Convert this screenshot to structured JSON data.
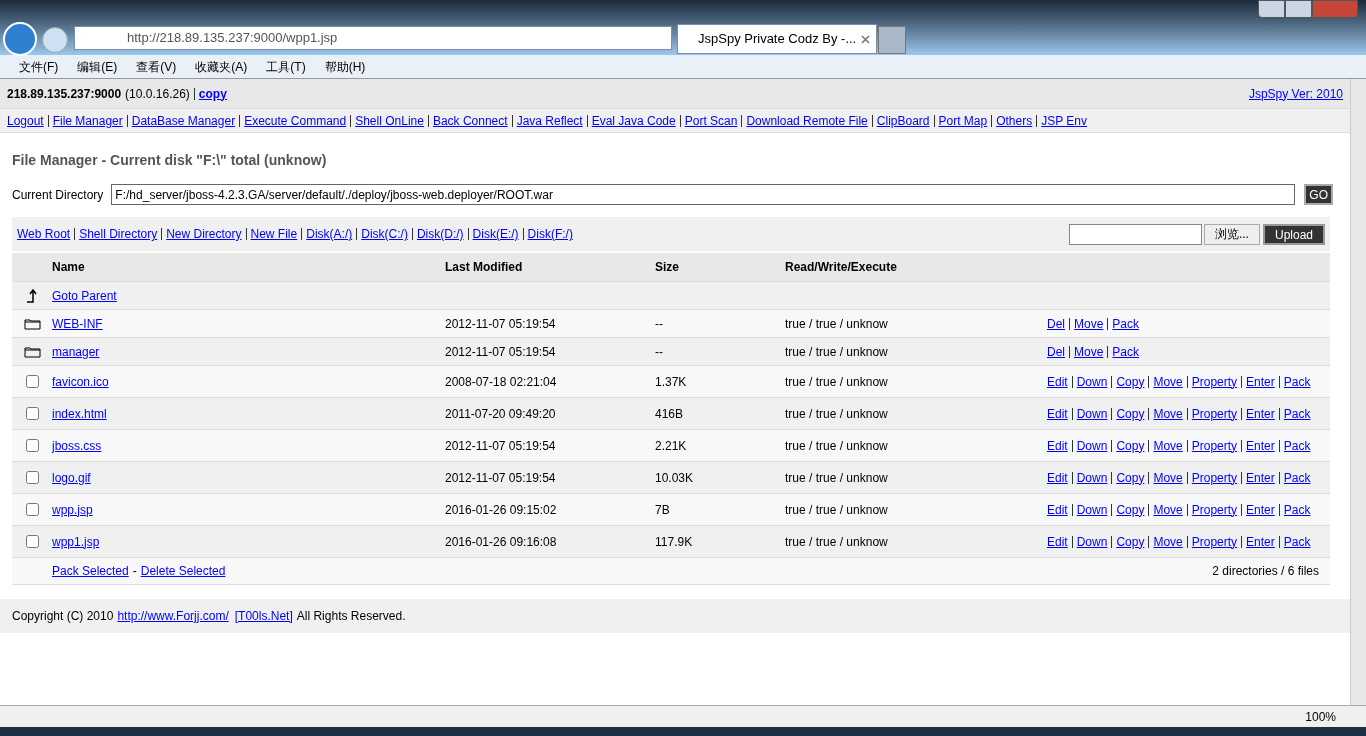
{
  "browser": {
    "address": "http://218.89.135.237:9000/wpp1.jsp",
    "tab_title": "JspSpy Private Codz By -...",
    "menu": [
      "文件(F)",
      "编辑(E)",
      "查看(V)",
      "收藏夹(A)",
      "工具(T)",
      "帮助(H)"
    ],
    "zoom": "100%"
  },
  "header": {
    "host": "218.89.135.237:9000",
    "ip": "(10.0.16.26)",
    "copy_link": "copy",
    "version_link": "JspSpy Ver: 2010"
  },
  "nav": [
    "Logout",
    "File Manager",
    "DataBase Manager",
    "Execute Command",
    "Shell OnLine",
    "Back Connect",
    "Java Reflect",
    "Eval Java Code",
    "Port Scan",
    "Download Remote File",
    "ClipBoard",
    "Port Map",
    "Others",
    "JSP Env"
  ],
  "title": "File Manager - Current disk \"F:\\\" total (unknow)",
  "directory": {
    "label": "Current Directory",
    "value": "F:/hd_server/jboss-4.2.3.GA/server/default/./deploy/jboss-web.deployer/ROOT.war",
    "go": "GO"
  },
  "shortcuts": [
    "Web Root",
    "Shell Directory",
    "New Directory",
    "New File",
    "Disk(A:/)",
    "Disk(C:/)",
    "Disk(D:/)",
    "Disk(E:/)",
    "Disk(F:/)"
  ],
  "upload": {
    "browse": "浏览...",
    "button": "Upload"
  },
  "table": {
    "columns": [
      "Name",
      "Last Modified",
      "Size",
      "Read/Write/Execute"
    ],
    "rows": [
      {
        "kind": "parent",
        "name": "Goto Parent"
      },
      {
        "kind": "dir",
        "name": "WEB-INF",
        "modified": "2012-11-07 05:19:54",
        "size": "--",
        "rwx": "true / true / unknow",
        "actions": [
          "Del",
          "Move",
          "Pack"
        ]
      },
      {
        "kind": "dir",
        "name": "manager",
        "modified": "2012-11-07 05:19:54",
        "size": "--",
        "rwx": "true / true / unknow",
        "actions": [
          "Del",
          "Move",
          "Pack"
        ]
      },
      {
        "kind": "file",
        "checked": false,
        "name": "favicon.ico",
        "modified": "2008-07-18 02:21:04",
        "size": "1.37K",
        "rwx": "true / true / unknow",
        "actions": [
          "Edit",
          "Down",
          "Copy",
          "Move",
          "Property",
          "Enter",
          "Pack"
        ]
      },
      {
        "kind": "file",
        "checked": false,
        "name": "index.html",
        "modified": "2011-07-20 09:49:20",
        "size": "416B",
        "rwx": "true / true / unknow",
        "actions": [
          "Edit",
          "Down",
          "Copy",
          "Move",
          "Property",
          "Enter",
          "Pack"
        ]
      },
      {
        "kind": "file",
        "checked": false,
        "name": "jboss.css",
        "modified": "2012-11-07 05:19:54",
        "size": "2.21K",
        "rwx": "true / true / unknow",
        "actions": [
          "Edit",
          "Down",
          "Copy",
          "Move",
          "Property",
          "Enter",
          "Pack"
        ]
      },
      {
        "kind": "file",
        "checked": false,
        "name": "logo.gif",
        "modified": "2012-11-07 05:19:54",
        "size": "10.03K",
        "rwx": "true / true / unknow",
        "actions": [
          "Edit",
          "Down",
          "Copy",
          "Move",
          "Property",
          "Enter",
          "Pack"
        ]
      },
      {
        "kind": "file",
        "checked": false,
        "name": "wpp.jsp",
        "modified": "2016-01-26 09:15:02",
        "size": "7B",
        "rwx": "true / true / unknow",
        "actions": [
          "Edit",
          "Down",
          "Copy",
          "Move",
          "Property",
          "Enter",
          "Pack"
        ]
      },
      {
        "kind": "file",
        "checked": false,
        "name": "wpp1.jsp",
        "modified": "2016-01-26 09:16:08",
        "size": "117.9K",
        "rwx": "true / true / unknow",
        "actions": [
          "Edit",
          "Down",
          "Copy",
          "Move",
          "Property",
          "Enter",
          "Pack"
        ]
      }
    ],
    "footer_links": [
      "Pack Selected",
      "Delete Selected"
    ],
    "separator": "-",
    "summary": "2 directories / 6 files"
  },
  "copyright": {
    "text": "Copyright (C) 2010",
    "site_link": "http://www.Forjj.com/",
    "tools_link": "[T00ls.Net]",
    "rights": "All Rights Reserved."
  }
}
